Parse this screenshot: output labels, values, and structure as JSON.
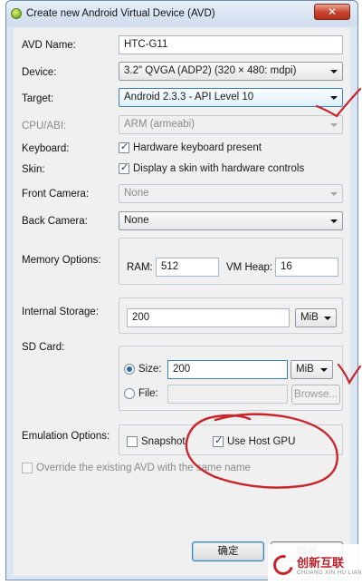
{
  "window": {
    "title": "Create new Android Virtual Device (AVD)",
    "close_glyph": "✕"
  },
  "fields": {
    "avd_name": {
      "label": "AVD Name:",
      "value": "HTC-G11"
    },
    "device": {
      "label": "Device:",
      "value": "3.2\" QVGA (ADP2) (320 × 480: mdpi)"
    },
    "target": {
      "label": "Target:",
      "value": "Android 2.3.3 - API Level 10"
    },
    "cpu_abi": {
      "label": "CPU/ABI:",
      "value": "ARM (armeabi)"
    },
    "keyboard": {
      "label": "Keyboard:",
      "checkbox_label": "Hardware keyboard present",
      "checked": true
    },
    "skin": {
      "label": "Skin:",
      "checkbox_label": "Display a skin with hardware controls",
      "checked": true
    },
    "front_camera": {
      "label": "Front Camera:",
      "value": "None"
    },
    "back_camera": {
      "label": "Back Camera:",
      "value": "None"
    },
    "memory": {
      "label": "Memory Options:",
      "ram_label": "RAM:",
      "ram_value": "512",
      "vm_heap_label": "VM Heap:",
      "vm_heap_value": "16"
    },
    "internal_storage": {
      "label": "Internal Storage:",
      "value": "200",
      "unit": "MiB"
    },
    "sd_card": {
      "label": "SD Card:",
      "size_label": "Size:",
      "size_value": "200",
      "size_unit": "MiB",
      "file_label": "File:",
      "browse_label": "Browse...",
      "selected": "size"
    },
    "emulation": {
      "label": "Emulation Options:",
      "snapshot_label": "Snapshot",
      "snapshot_checked": false,
      "host_gpu_label": "Use Host GPU",
      "host_gpu_checked": true
    },
    "override": {
      "label": "Override the existing AVD with the same name",
      "checked": false
    }
  },
  "buttons": {
    "ok_label": "确定",
    "cancel_label": "取消"
  },
  "icons": {
    "app": "android-sdk-icon",
    "combo_arrow": "chevron-down-icon",
    "watermark_logo": "chuangxin-logo"
  },
  "watermark": {
    "main": "创新互联",
    "sub": "CHUANG XIN HU LIAN"
  },
  "colors": {
    "annotation": "#c8262c",
    "selection_border": "#3c7fb1"
  }
}
